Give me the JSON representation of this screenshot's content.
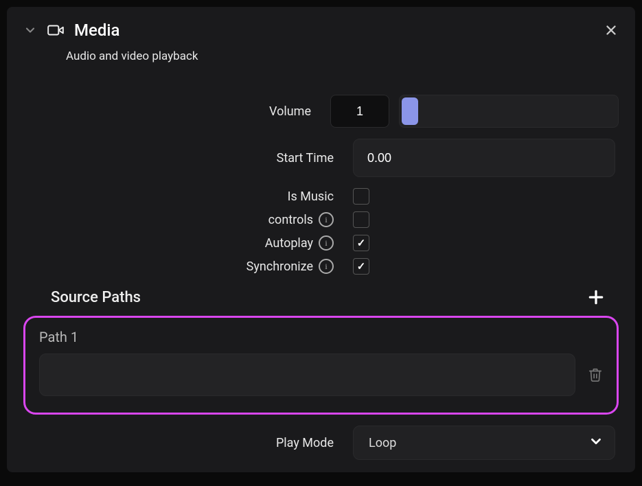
{
  "header": {
    "title": "Media",
    "subtitle": "Audio and video playback"
  },
  "form": {
    "volume": {
      "label": "Volume",
      "value": "1"
    },
    "start_time": {
      "label": "Start Time",
      "value": "0.00"
    },
    "is_music": {
      "label": "Is Music",
      "checked": false
    },
    "controls": {
      "label": "controls",
      "checked": false
    },
    "autoplay": {
      "label": "Autoplay",
      "checked": true
    },
    "synchronize": {
      "label": "Synchronize",
      "checked": true
    }
  },
  "source_paths": {
    "title": "Source Paths",
    "items": [
      {
        "label": "Path 1",
        "value": ""
      }
    ]
  },
  "play_mode": {
    "label": "Play Mode",
    "selected": "Loop"
  }
}
